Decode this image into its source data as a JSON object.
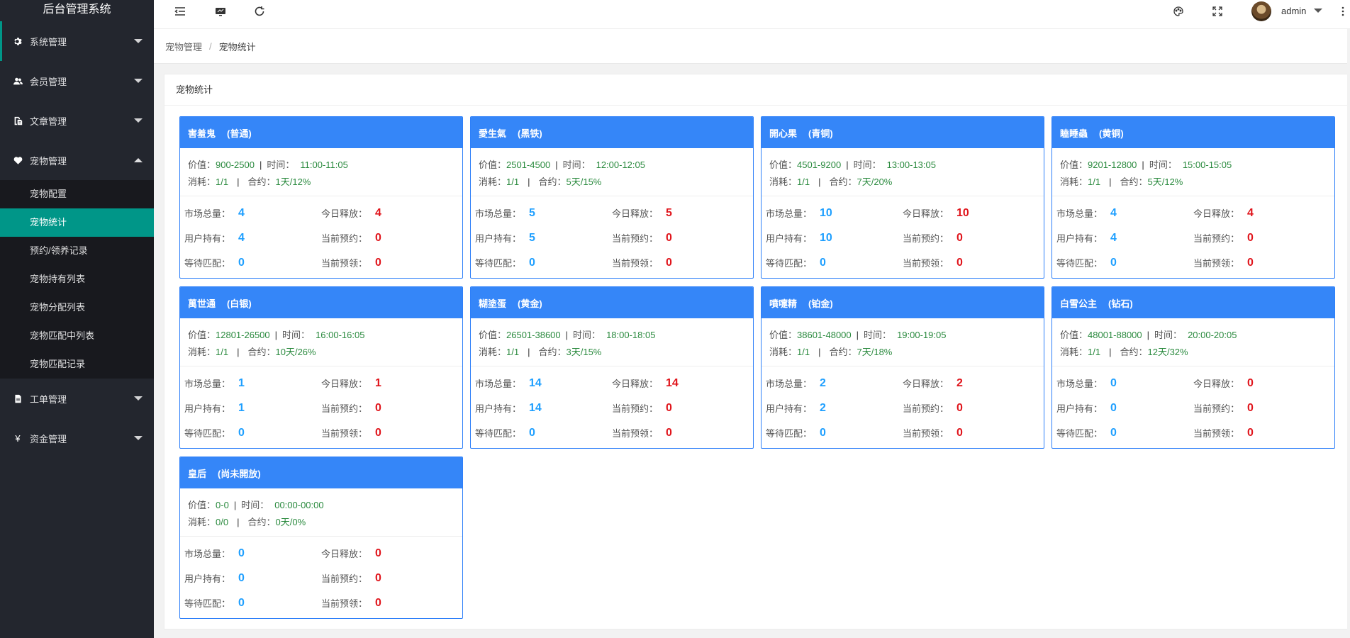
{
  "app": {
    "title": "后台管理系统"
  },
  "sidebar": {
    "items": [
      {
        "label": "系统管理",
        "icon": "gear-icon"
      },
      {
        "label": "会员管理",
        "icon": "users-icon"
      },
      {
        "label": "文章管理",
        "icon": "document-icon"
      },
      {
        "label": "宠物管理",
        "icon": "heart-icon",
        "children": [
          "宠物配置",
          "宠物统计",
          "预约/领养记录",
          "宠物持有列表",
          "宠物分配列表",
          "宠物匹配中列表",
          "宠物匹配记录"
        ]
      },
      {
        "label": "工单管理",
        "icon": "file-icon"
      },
      {
        "label": "资金管理",
        "icon": "yen-icon",
        "glyph": "¥"
      }
    ]
  },
  "header": {
    "username": "admin"
  },
  "breadcrumb": {
    "parent": "宠物管理",
    "separator": "/",
    "current": "宠物统计"
  },
  "panel": {
    "title": "宠物统计"
  },
  "labels": {
    "value": "价值：",
    "time": "时间：",
    "consume": "消耗：",
    "contract": "合约：",
    "market_total": "市场总量：",
    "today_release": "今日释放：",
    "user_hold": "用户持有：",
    "current_reserve": "当前预约：",
    "waiting_match": "等待匹配：",
    "current_claim": "当前预领：",
    "separator": "|"
  },
  "cards": [
    {
      "name": "害羞鬼",
      "level": "(普通)",
      "value": "900-2500",
      "time": "11:00-11:05",
      "consume": "1/1",
      "contract": "1天/12%",
      "market_total": "4",
      "today_release": "4",
      "user_hold": "4",
      "current_reserve": "0",
      "waiting_match": "0",
      "current_claim": "0"
    },
    {
      "name": "愛生氣",
      "level": "(黑铁)",
      "value": "2501-4500",
      "time": "12:00-12:05",
      "consume": "1/1",
      "contract": "5天/15%",
      "market_total": "5",
      "today_release": "5",
      "user_hold": "5",
      "current_reserve": "0",
      "waiting_match": "0",
      "current_claim": "0"
    },
    {
      "name": "開心果",
      "level": "(青铜)",
      "value": "4501-9200",
      "time": "13:00-13:05",
      "consume": "1/1",
      "contract": "7天/20%",
      "market_total": "10",
      "today_release": "10",
      "user_hold": "10",
      "current_reserve": "0",
      "waiting_match": "0",
      "current_claim": "0"
    },
    {
      "name": "瞌睡蟲",
      "level": "(黄铜)",
      "value": "9201-12800",
      "time": "15:00-15:05",
      "consume": "1/1",
      "contract": "5天/12%",
      "market_total": "4",
      "today_release": "4",
      "user_hold": "4",
      "current_reserve": "0",
      "waiting_match": "0",
      "current_claim": "0"
    },
    {
      "name": "萬世通",
      "level": "(白银)",
      "value": "12801-26500",
      "time": "16:00-16:05",
      "consume": "1/1",
      "contract": "10天/26%",
      "market_total": "1",
      "today_release": "1",
      "user_hold": "1",
      "current_reserve": "0",
      "waiting_match": "0",
      "current_claim": "0"
    },
    {
      "name": "糊塗蛋",
      "level": "(黄金)",
      "value": "26501-38600",
      "time": "18:00-18:05",
      "consume": "1/1",
      "contract": "3天/15%",
      "market_total": "14",
      "today_release": "14",
      "user_hold": "14",
      "current_reserve": "0",
      "waiting_match": "0",
      "current_claim": "0"
    },
    {
      "name": "噴嚏精",
      "level": "(铂金)",
      "value": "38601-48000",
      "time": "19:00-19:05",
      "consume": "1/1",
      "contract": "7天/18%",
      "market_total": "2",
      "today_release": "2",
      "user_hold": "2",
      "current_reserve": "0",
      "waiting_match": "0",
      "current_claim": "0"
    },
    {
      "name": "白雪公主",
      "level": "(钻石)",
      "value": "48001-88000",
      "time": "20:00-20:05",
      "consume": "1/1",
      "contract": "12天/32%",
      "market_total": "0",
      "today_release": "0",
      "user_hold": "0",
      "current_reserve": "0",
      "waiting_match": "0",
      "current_claim": "0"
    },
    {
      "name": "皇后",
      "level": "(尚未開放)",
      "value": "0-0",
      "time": "00:00-00:00",
      "consume": "0/0",
      "contract": "0天/0%",
      "market_total": "0",
      "today_release": "0",
      "user_hold": "0",
      "current_reserve": "0",
      "waiting_match": "0",
      "current_claim": "0"
    }
  ],
  "colors": {
    "sidebar_bg": "#23262e",
    "accent": "#009688",
    "card_head": "#3586f8",
    "num_blue": "#1e9fff",
    "num_red": "#e0141b",
    "value_green": "#2a8a3e"
  }
}
